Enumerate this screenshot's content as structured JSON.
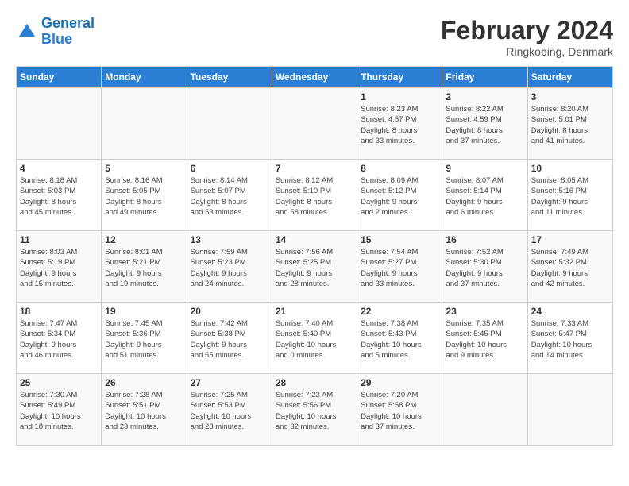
{
  "header": {
    "logo_line1": "General",
    "logo_line2": "Blue",
    "month": "February 2024",
    "location": "Ringkobing, Denmark"
  },
  "weekdays": [
    "Sunday",
    "Monday",
    "Tuesday",
    "Wednesday",
    "Thursday",
    "Friday",
    "Saturday"
  ],
  "weeks": [
    [
      {
        "day": "",
        "info": ""
      },
      {
        "day": "",
        "info": ""
      },
      {
        "day": "",
        "info": ""
      },
      {
        "day": "",
        "info": ""
      },
      {
        "day": "1",
        "info": "Sunrise: 8:23 AM\nSunset: 4:57 PM\nDaylight: 8 hours\nand 33 minutes."
      },
      {
        "day": "2",
        "info": "Sunrise: 8:22 AM\nSunset: 4:59 PM\nDaylight: 8 hours\nand 37 minutes."
      },
      {
        "day": "3",
        "info": "Sunrise: 8:20 AM\nSunset: 5:01 PM\nDaylight: 8 hours\nand 41 minutes."
      }
    ],
    [
      {
        "day": "4",
        "info": "Sunrise: 8:18 AM\nSunset: 5:03 PM\nDaylight: 8 hours\nand 45 minutes."
      },
      {
        "day": "5",
        "info": "Sunrise: 8:16 AM\nSunset: 5:05 PM\nDaylight: 8 hours\nand 49 minutes."
      },
      {
        "day": "6",
        "info": "Sunrise: 8:14 AM\nSunset: 5:07 PM\nDaylight: 8 hours\nand 53 minutes."
      },
      {
        "day": "7",
        "info": "Sunrise: 8:12 AM\nSunset: 5:10 PM\nDaylight: 8 hours\nand 58 minutes."
      },
      {
        "day": "8",
        "info": "Sunrise: 8:09 AM\nSunset: 5:12 PM\nDaylight: 9 hours\nand 2 minutes."
      },
      {
        "day": "9",
        "info": "Sunrise: 8:07 AM\nSunset: 5:14 PM\nDaylight: 9 hours\nand 6 minutes."
      },
      {
        "day": "10",
        "info": "Sunrise: 8:05 AM\nSunset: 5:16 PM\nDaylight: 9 hours\nand 11 minutes."
      }
    ],
    [
      {
        "day": "11",
        "info": "Sunrise: 8:03 AM\nSunset: 5:19 PM\nDaylight: 9 hours\nand 15 minutes."
      },
      {
        "day": "12",
        "info": "Sunrise: 8:01 AM\nSunset: 5:21 PM\nDaylight: 9 hours\nand 19 minutes."
      },
      {
        "day": "13",
        "info": "Sunrise: 7:59 AM\nSunset: 5:23 PM\nDaylight: 9 hours\nand 24 minutes."
      },
      {
        "day": "14",
        "info": "Sunrise: 7:56 AM\nSunset: 5:25 PM\nDaylight: 9 hours\nand 28 minutes."
      },
      {
        "day": "15",
        "info": "Sunrise: 7:54 AM\nSunset: 5:27 PM\nDaylight: 9 hours\nand 33 minutes."
      },
      {
        "day": "16",
        "info": "Sunrise: 7:52 AM\nSunset: 5:30 PM\nDaylight: 9 hours\nand 37 minutes."
      },
      {
        "day": "17",
        "info": "Sunrise: 7:49 AM\nSunset: 5:32 PM\nDaylight: 9 hours\nand 42 minutes."
      }
    ],
    [
      {
        "day": "18",
        "info": "Sunrise: 7:47 AM\nSunset: 5:34 PM\nDaylight: 9 hours\nand 46 minutes."
      },
      {
        "day": "19",
        "info": "Sunrise: 7:45 AM\nSunset: 5:36 PM\nDaylight: 9 hours\nand 51 minutes."
      },
      {
        "day": "20",
        "info": "Sunrise: 7:42 AM\nSunset: 5:38 PM\nDaylight: 9 hours\nand 55 minutes."
      },
      {
        "day": "21",
        "info": "Sunrise: 7:40 AM\nSunset: 5:40 PM\nDaylight: 10 hours\nand 0 minutes."
      },
      {
        "day": "22",
        "info": "Sunrise: 7:38 AM\nSunset: 5:43 PM\nDaylight: 10 hours\nand 5 minutes."
      },
      {
        "day": "23",
        "info": "Sunrise: 7:35 AM\nSunset: 5:45 PM\nDaylight: 10 hours\nand 9 minutes."
      },
      {
        "day": "24",
        "info": "Sunrise: 7:33 AM\nSunset: 5:47 PM\nDaylight: 10 hours\nand 14 minutes."
      }
    ],
    [
      {
        "day": "25",
        "info": "Sunrise: 7:30 AM\nSunset: 5:49 PM\nDaylight: 10 hours\nand 18 minutes."
      },
      {
        "day": "26",
        "info": "Sunrise: 7:28 AM\nSunset: 5:51 PM\nDaylight: 10 hours\nand 23 minutes."
      },
      {
        "day": "27",
        "info": "Sunrise: 7:25 AM\nSunset: 5:53 PM\nDaylight: 10 hours\nand 28 minutes."
      },
      {
        "day": "28",
        "info": "Sunrise: 7:23 AM\nSunset: 5:56 PM\nDaylight: 10 hours\nand 32 minutes."
      },
      {
        "day": "29",
        "info": "Sunrise: 7:20 AM\nSunset: 5:58 PM\nDaylight: 10 hours\nand 37 minutes."
      },
      {
        "day": "",
        "info": ""
      },
      {
        "day": "",
        "info": ""
      }
    ]
  ]
}
